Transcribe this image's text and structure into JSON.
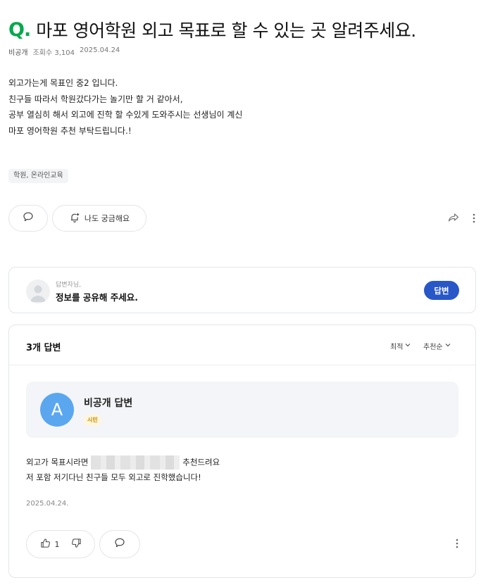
{
  "question": {
    "mark": "Q",
    "title": "마포 영어학원 외고 목표로 할 수 있는 곳 알려주세요.",
    "author": "비공개",
    "views": "조회수 3,104",
    "date": "2025.04.24",
    "body": [
      "외고가는게 목표인 중2 입니다.",
      "친구들 따라서 학원갔다가는 놀기만 할 거 같아서,",
      "공부 열심히 해서 외고에 진학 할 수있게 도와주시는 선생님이 계신",
      "마포 영어학원 추천 부탁드립니다.!"
    ],
    "tag": "학원, 온라인교육"
  },
  "actions": {
    "curious_label": "나도 궁금해요",
    "comment_icon": "speech-bubble-icon",
    "curious_icon": "bell-plus-icon",
    "share_icon": "share-arrow-icon",
    "more_icon": "vertical-dots-icon"
  },
  "answer_prompt": {
    "small": "답변자님,",
    "main": "정보를 공유해 주세요.",
    "button": "답변",
    "accent": "#2857c8"
  },
  "answers": {
    "header": "3개 답변",
    "sort": [
      "최적",
      "추천순"
    ],
    "items": [
      {
        "avatar_letter": "A",
        "name": "비공개 답변",
        "badge": "시민",
        "line1_before": "외고가 목표시라면",
        "line1_after": "추천드려요",
        "line2": "저 포함 저기다닌 친구들 모두 외고로 진학했습니다!",
        "date": "2025.04.24.",
        "likes": "1"
      }
    ]
  },
  "colors": {
    "brand_green": "#03a94d",
    "avatar_blue": "#5aa7f0",
    "badge_text": "#c48a00"
  }
}
